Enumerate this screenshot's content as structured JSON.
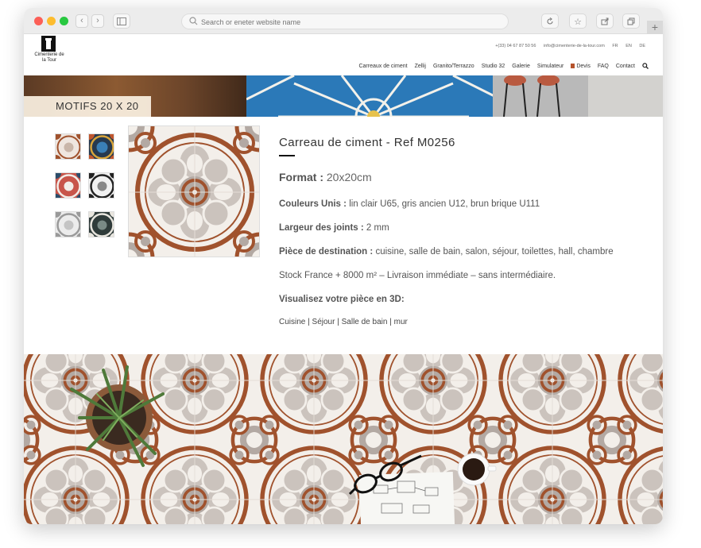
{
  "browser": {
    "url_placeholder": "Search or eneter website name",
    "back_icon": "chevron-left-icon",
    "forward_icon": "chevron-right-icon"
  },
  "site": {
    "logo_text": "Cimenterie de la Tour",
    "phone": "+(33) 04 67 87 50 56",
    "email": "info@cimenterie-de-la-tour.com",
    "languages": [
      "FR",
      "EN",
      "DE"
    ],
    "nav": [
      "Carreaux de ciment",
      "Zellij",
      "Granito/Terrazzo",
      "Studio 32",
      "Galerie",
      "Simulateur",
      "Devis",
      "FAQ",
      "Contact"
    ]
  },
  "banner": {
    "label": "MOTIFS 20 X 20"
  },
  "product": {
    "title": "Carreau de ciment - Ref M0256",
    "format_label": "Format :",
    "format_value": "20x20cm",
    "colors_label": "Couleurs Unis :",
    "colors_value": "lin clair U65, gris ancien U12, brun brique U111",
    "joints_label": "Largeur des joints :",
    "joints_value": "2 mm",
    "rooms_label": "Pièce de destination :",
    "rooms_value": "cuisine, salle de bain, salon, séjour, toilettes, hall, chambre",
    "stock": "Stock France + 8000 m² – Livraison immédiate – sans intermédiaire.",
    "visualize_label": "Visualisez votre pièce en 3D:",
    "rooms_3d": [
      "Cuisine",
      "Séjour",
      "Salle de bain",
      "mur"
    ],
    "separator": "|"
  },
  "colors": {
    "brick": "#a0522d",
    "grey": "#b3a9a3",
    "cream": "#f3efea",
    "chrome": "#ececec"
  }
}
